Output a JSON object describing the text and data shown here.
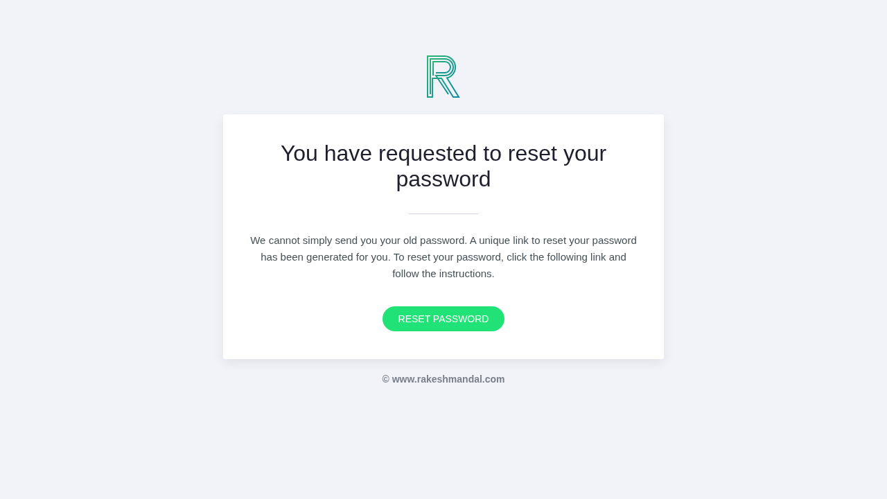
{
  "card": {
    "title": "You have requested to reset your password",
    "message": "We cannot simply send you your old password. A unique link to reset your password has been generated for you. To reset your password, click the following link and follow the instructions.",
    "button": "RESET PASSWORD"
  },
  "footer": "© www.rakeshmandal.com"
}
